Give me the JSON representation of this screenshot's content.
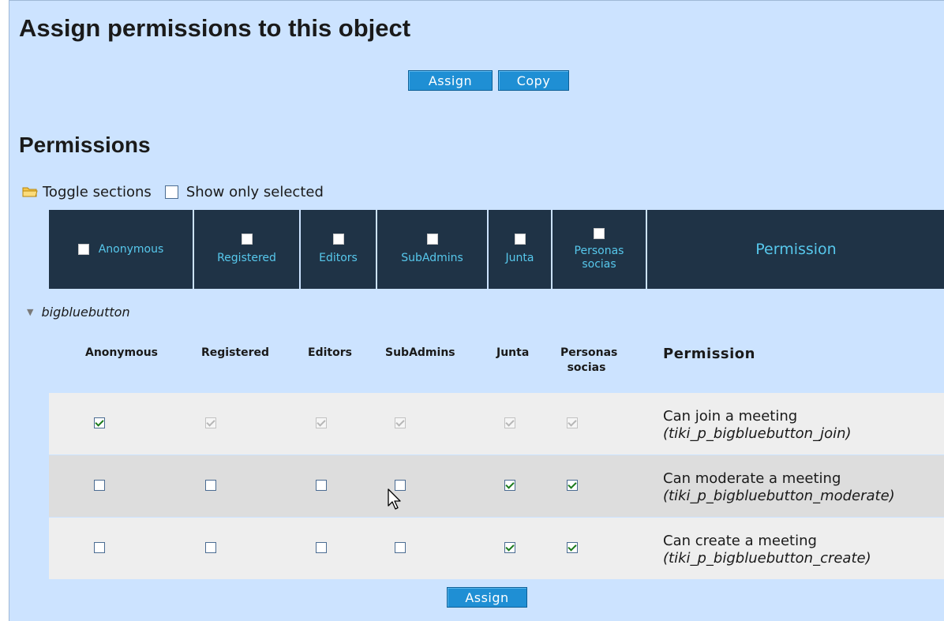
{
  "page": {
    "title": "Assign permissions to this object",
    "buttons": {
      "assign": "Assign",
      "copy": "Copy"
    },
    "permissions_heading": "Permissions",
    "toggle_sections": "Toggle sections",
    "show_only_selected": "Show only selected",
    "icons": {
      "folder": "folder-icon",
      "expand": "triangle-down-icon",
      "cursor": "mouse-pointer-icon"
    }
  },
  "groups": {
    "anonymous": "Anonymous",
    "registered": "Registered",
    "editors": "Editors",
    "subadmins": "SubAdmins",
    "junta": "Junta",
    "personas_1": "Personas",
    "personas_2": "socias",
    "permission": "Permission"
  },
  "section": {
    "name": "bigbluebutton",
    "headers": {
      "anonymous": "Anonymous",
      "registered": "Registered",
      "editors": "Editors",
      "subadmins": "SubAdmins",
      "junta": "Junta",
      "personas_1": "Personas",
      "personas_2": "socias",
      "permission": "Permission"
    },
    "rows": [
      {
        "label": "Can join a meeting",
        "code": "(tiki_p_bigbluebutton_join)",
        "checked": [
          true,
          true,
          true,
          true,
          true,
          true
        ],
        "disabled": [
          false,
          true,
          true,
          true,
          true,
          true
        ]
      },
      {
        "label": "Can moderate a meeting",
        "code": "(tiki_p_bigbluebutton_moderate)",
        "checked": [
          false,
          false,
          false,
          false,
          true,
          true
        ],
        "disabled": [
          false,
          false,
          false,
          false,
          false,
          false
        ]
      },
      {
        "label": "Can create a meeting",
        "code": "(tiki_p_bigbluebutton_create)",
        "checked": [
          false,
          false,
          false,
          false,
          true,
          true
        ],
        "disabled": [
          false,
          false,
          false,
          false,
          false,
          false
        ]
      }
    ]
  },
  "bottom_assign": "Assign"
}
